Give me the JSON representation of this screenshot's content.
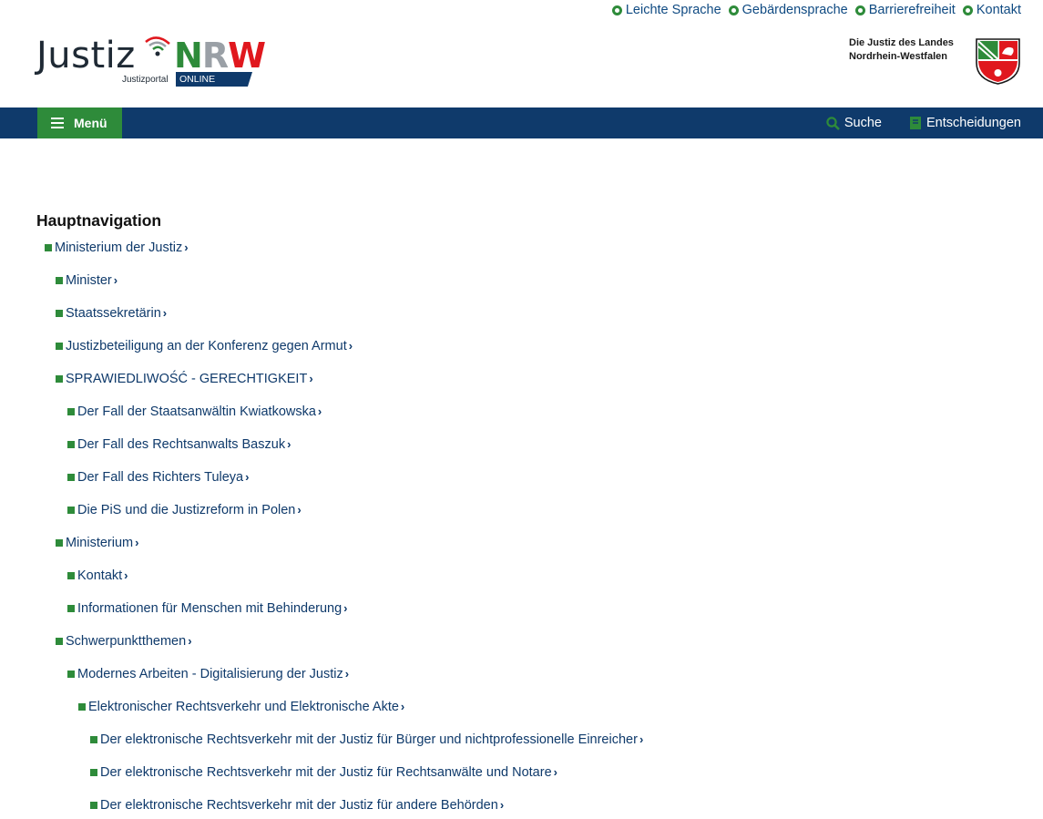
{
  "utility_links": [
    {
      "label": "Leichte Sprache",
      "icon": "leichte-sprache-icon"
    },
    {
      "label": "Gebärdensprache",
      "icon": "gebaerdensprache-icon"
    },
    {
      "label": "Barrierefreiheit",
      "icon": "barrierefreiheit-icon"
    },
    {
      "label": "Kontakt",
      "icon": "kontakt-icon"
    }
  ],
  "logo": {
    "justiz": "Justiz",
    "n": "N",
    "r": "R",
    "w": "W",
    "portal": "Justizportal",
    "online": "ONLINE"
  },
  "state": {
    "line1": "Die Justiz des Landes",
    "line2": "Nordrhein-Westfalen"
  },
  "navbar": {
    "menu_label": "Menü",
    "search_label": "Suche",
    "decisions_label": "Entscheidungen"
  },
  "colors": {
    "navy": "#0f3a6b",
    "green": "#2e8b3a",
    "red": "#e0181e"
  },
  "main": {
    "heading": "Hauptnavigation",
    "items": [
      {
        "label": "Ministerium der Justiz",
        "level": 0
      },
      {
        "label": "Minister",
        "level": 1
      },
      {
        "label": "Staatssekretärin",
        "level": 1
      },
      {
        "label": "Justizbeteiligung an der Konferenz gegen Armut",
        "level": 1
      },
      {
        "label": "SPRAWIEDLIWOŚĆ - GERECHTIGKEIT",
        "level": 1
      },
      {
        "label": "Der Fall der Staatsanwältin Kwiatkowska",
        "level": 2
      },
      {
        "label": "Der Fall des Rechtsanwalts Baszuk",
        "level": 2
      },
      {
        "label": "Der Fall des Richters Tuleya",
        "level": 2
      },
      {
        "label": "Die PiS und die Justizreform in Polen",
        "level": 2
      },
      {
        "label": "Ministerium",
        "level": 1
      },
      {
        "label": "Kontakt",
        "level": 2
      },
      {
        "label": "Informationen für Menschen mit Behinderung",
        "level": 2
      },
      {
        "label": "Schwerpunktthemen",
        "level": 1
      },
      {
        "label": "Modernes Arbeiten - Digitalisierung der Justiz",
        "level": 2
      },
      {
        "label": "Elektronischer Rechtsverkehr und Elektronische Akte",
        "level": 3
      },
      {
        "label": "Der elektronische Rechtsverkehr mit der Justiz für Bürger und nichtprofessionelle Einreicher",
        "level": 4
      },
      {
        "label": "Der elektronische Rechtsverkehr mit der Justiz für Rechtsanwälte und Notare",
        "level": 4
      },
      {
        "label": "Der elektronische Rechtsverkehr mit der Justiz für andere Behörden",
        "level": 4
      }
    ]
  }
}
